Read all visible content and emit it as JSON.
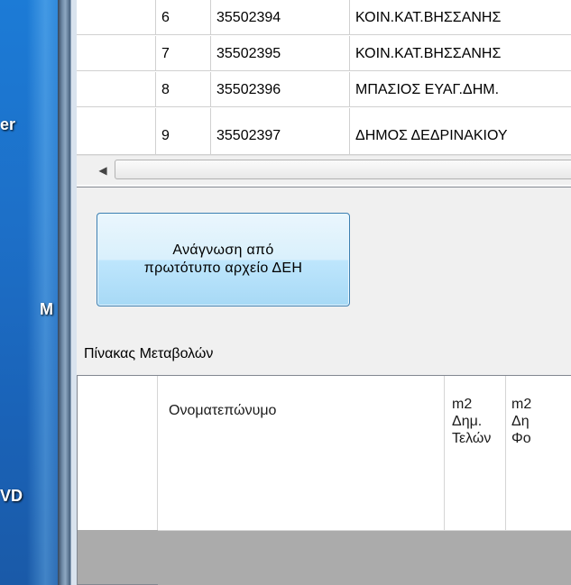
{
  "desktop": {
    "labels": [
      "er",
      "M",
      "VD"
    ]
  },
  "records_grid": {
    "rows": [
      {
        "index": "6",
        "code": "35502394",
        "name": "ΚΟΙΝ.ΚΑΤ.ΒΗΣΣΑΝΗΣ"
      },
      {
        "index": "7",
        "code": "35502395",
        "name": "ΚΟΙΝ.ΚΑΤ.ΒΗΣΣΑΝΗΣ"
      },
      {
        "index": "8",
        "code": "35502396",
        "name": "ΜΠΑΣΙΟΣ ΕΥΑΓ.ΔΗΜ."
      },
      {
        "index": "9",
        "code": "35502397",
        "name": "ΔΗΜΟΣ ΔΕΔΡΙΝΑΚΙΟΥ"
      }
    ],
    "scroll_left_arrow": "◀"
  },
  "read_button": {
    "label": "Ανάγνωση από\nπρωτότυπο αρχείο ΔΕΗ"
  },
  "changes": {
    "title": "Πίνακας Μεταβολών",
    "columns": [
      {
        "label": "Ονοματεπώνυμο"
      },
      {
        "label": "m2\nΔημ.\nΤελών"
      },
      {
        "label": "m2\nΔη\nΦο"
      }
    ]
  }
}
